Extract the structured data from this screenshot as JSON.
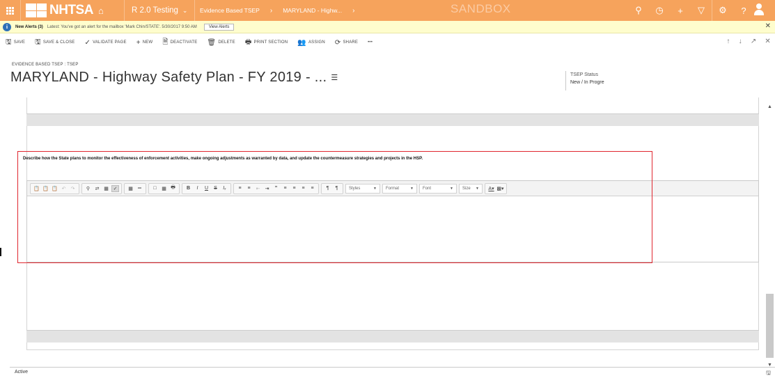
{
  "nav": {
    "brand": "NHTSA",
    "app_name": "R 2.0 Testing",
    "breadcrumb": [
      "Evidence Based TSEP",
      "MARYLAND - Highw..."
    ],
    "environment": "SANDBOX",
    "icons": [
      "search-icon",
      "history-icon",
      "plus-icon",
      "filter-icon",
      "settings-icon",
      "help-icon",
      "user-icon"
    ]
  },
  "alert": {
    "title": "New Alerts (3)",
    "message": "Latest: You've got an alert for the mailbox 'Mark Chin/STATE'. 5/30/2017 9:50 AM",
    "button": "View Alerts"
  },
  "commands": [
    {
      "label": "SAVE",
      "icon": "save-icon"
    },
    {
      "label": "SAVE & CLOSE",
      "icon": "save-close-icon"
    },
    {
      "label": "VALIDATE PAGE",
      "icon": "validate-icon"
    },
    {
      "label": "NEW",
      "icon": "plus-icon"
    },
    {
      "label": "DEACTIVATE",
      "icon": "deactivate-icon"
    },
    {
      "label": "DELETE",
      "icon": "delete-icon"
    },
    {
      "label": "PRINT SECTION",
      "icon": "print-icon"
    },
    {
      "label": "ASSIGN",
      "icon": "assign-icon"
    },
    {
      "label": "SHARE",
      "icon": "share-icon"
    },
    {
      "label": "•••",
      "icon": "more-icon"
    }
  ],
  "header": {
    "entity": "EVIDENCE BASED TSEP : TSEP",
    "title": "MARYLAND - Highway Safety Plan - FY 2019 - ...",
    "status_label": "TSEP Status",
    "status_value": "New / In Progre"
  },
  "form": {
    "question": "Describe how the State plans to monitor the effectiveness of enforcement activities, make ongoing adjustments as warranted by data, and update the countermeasure strategies and projects in the HSP.",
    "editor_value": "",
    "combos": {
      "styles": "Styles",
      "format": "Format",
      "font": "Font",
      "size": "Size"
    }
  },
  "footer": {
    "status": "Active"
  }
}
